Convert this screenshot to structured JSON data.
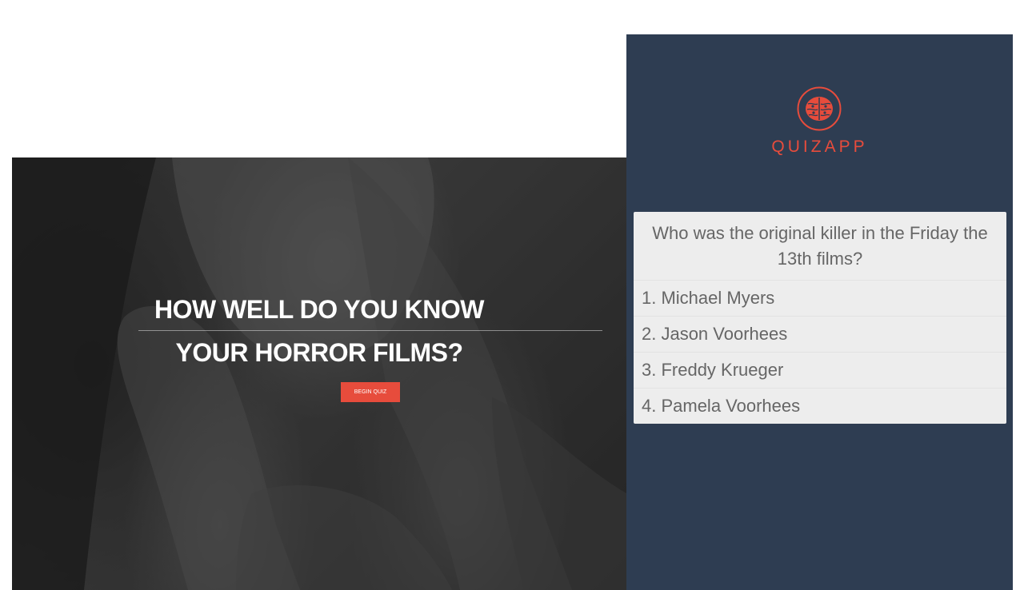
{
  "hero": {
    "title_line1": "HOW WELL DO YOU KNOW",
    "title_line2": "YOUR HORROR FILMS?",
    "begin_button_label": "BEGIN QUIZ"
  },
  "app": {
    "logo_text": "QUIZAPP",
    "logo_icon": "brain-icon",
    "question": "Who was the original killer in the Friday the 13th films?",
    "answers": [
      "1. Michael Myers",
      "2. Jason Voorhees",
      "3. Freddy Krueger",
      "4. Pamela Voorhees"
    ]
  },
  "colors": {
    "accent": "#e74c3c",
    "panel_bg": "#2e3d52",
    "card_bg": "#ededed",
    "text_gray": "#666666"
  }
}
